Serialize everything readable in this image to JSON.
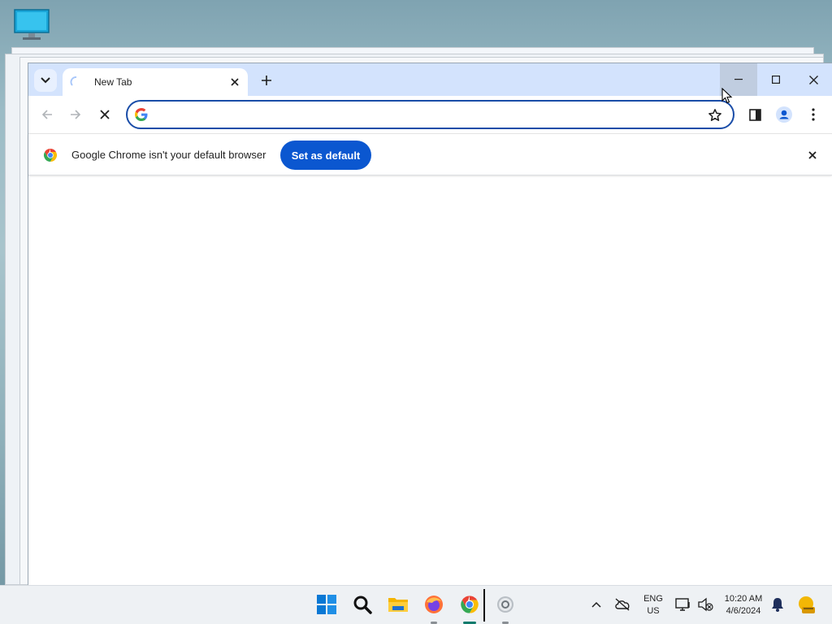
{
  "browser": {
    "tab": {
      "title": "New Tab"
    },
    "omnibox": {
      "value": "",
      "placeholder": ""
    },
    "infobar": {
      "message": "Google Chrome isn't your default browser",
      "button_label": "Set as default"
    }
  },
  "taskbar": {
    "language": {
      "line1": "ENG",
      "line2": "US"
    },
    "clock": {
      "time": "10:20 AM",
      "date": "4/6/2024"
    },
    "apps": [
      "windows-start",
      "search",
      "file-explorer",
      "firefox",
      "chrome",
      "settings"
    ]
  },
  "colors": {
    "titlebar": "#d3e3fd",
    "accent": "#0b57d0",
    "omnibox_border": "#1a4da8"
  }
}
